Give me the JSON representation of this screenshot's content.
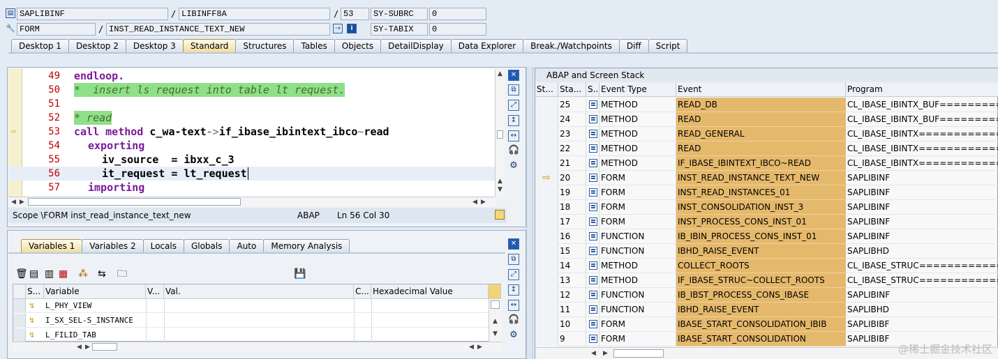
{
  "header": {
    "program_icon": "program-icon",
    "program": "SAPLIBINF",
    "include": "LIBINFF8A",
    "line": "53",
    "sysvar1_label": "SY-SUBRC",
    "sysvar1_value": "0",
    "event_type": "FORM",
    "event_name": "INST_READ_INSTANCE_TEXT_NEW",
    "sysvar2_label": "SY-TABIX",
    "sysvar2_value": "0",
    "sep_slash": "/"
  },
  "desktop_tabs": [
    "Desktop 1",
    "Desktop 2",
    "Desktop 3",
    "Standard",
    "Structures",
    "Tables",
    "Objects",
    "DetailDisplay",
    "Data Explorer",
    "Break./Watchpoints",
    "Diff",
    "Script"
  ],
  "code": {
    "lines": [
      {
        "no": "49",
        "text": "endloop."
      },
      {
        "no": "50",
        "text": "*  insert ls request into table lt request."
      },
      {
        "no": "51",
        "text": ""
      },
      {
        "no": "52",
        "text": "* read"
      },
      {
        "no": "53",
        "text": "call method c_wa-text->if_ibase_ibintext_ibco~read"
      },
      {
        "no": "54",
        "text": "exporting"
      },
      {
        "no": "55",
        "text": "iv_source  = ibxx_c_3"
      },
      {
        "no": "56",
        "text": "it_request = lt_request"
      },
      {
        "no": "57",
        "text": "importing"
      }
    ]
  },
  "status": {
    "scope": "Scope \\FORM inst_read_instance_text_new",
    "lang": "ABAP",
    "ln": "Ln  56 Col  30"
  },
  "var_tabs": [
    "Variables 1",
    "Variables 2",
    "Locals",
    "Globals",
    "Auto",
    "Memory Analysis"
  ],
  "var_table": {
    "headers": [
      "S...",
      "Variable",
      "V...",
      "Val.",
      "C...",
      "Hexadecimal Value"
    ],
    "rows": [
      "L_PHY_VIEW",
      "I_SX_SEL-S_INSTANCE",
      "L_FILID_TAB"
    ]
  },
  "stack": {
    "title": "ABAP and Screen Stack",
    "headers": [
      "St...",
      "Sta...",
      "S...",
      "Event Type",
      "Event",
      "Program"
    ],
    "rows": [
      {
        "no": "25",
        "type": "METHOD",
        "event": "READ_DB",
        "program": "CL_IBASE_IBINTX_BUF=========="
      },
      {
        "no": "24",
        "type": "METHOD",
        "event": "READ",
        "program": "CL_IBASE_IBINTX_BUF=========="
      },
      {
        "no": "23",
        "type": "METHOD",
        "event": "READ_GENERAL",
        "program": "CL_IBASE_IBINTX=============="
      },
      {
        "no": "22",
        "type": "METHOD",
        "event": "READ",
        "program": "CL_IBASE_IBINTX=============="
      },
      {
        "no": "21",
        "type": "METHOD",
        "event": "IF_IBASE_IBINTEXT_IBCO~READ",
        "program": "CL_IBASE_IBINTX=============="
      },
      {
        "no": "20",
        "type": "FORM",
        "event": "INST_READ_INSTANCE_TEXT_NEW",
        "program": "SAPLIBINF"
      },
      {
        "no": "19",
        "type": "FORM",
        "event": "INST_READ_INSTANCES_01",
        "program": "SAPLIBINF"
      },
      {
        "no": "18",
        "type": "FORM",
        "event": "INST_CONSOLIDATION_INST_3",
        "program": "SAPLIBINF"
      },
      {
        "no": "17",
        "type": "FORM",
        "event": "INST_PROCESS_CONS_INST_01",
        "program": "SAPLIBINF"
      },
      {
        "no": "16",
        "type": "FUNCTION",
        "event": "IB_IBIN_PROCESS_CONS_INST_01",
        "program": "SAPLIBINF"
      },
      {
        "no": "15",
        "type": "FUNCTION",
        "event": "IBHD_RAISE_EVENT",
        "program": "SAPLIBHD"
      },
      {
        "no": "14",
        "type": "METHOD",
        "event": "COLLECT_ROOTS",
        "program": "CL_IBASE_STRUC=============="
      },
      {
        "no": "13",
        "type": "METHOD",
        "event": "IF_IBASE_STRUC~COLLECT_ROOTS",
        "program": "CL_IBASE_STRUC=============="
      },
      {
        "no": "12",
        "type": "FUNCTION",
        "event": "IB_IBST_PROCESS_CONS_IBASE",
        "program": "SAPLIBINF"
      },
      {
        "no": "11",
        "type": "FUNCTION",
        "event": "IBHD_RAISE_EVENT",
        "program": "SAPLIBHD"
      },
      {
        "no": "10",
        "type": "FORM",
        "event": "IBASE_START_CONSOLIDATION_IBIB",
        "program": "SAPLIBIBF"
      },
      {
        "no": "9",
        "type": "FORM",
        "event": "IBASE_START_CONSOLIDATION",
        "program": "SAPLIBIBF"
      }
    ]
  },
  "watermark": "@稀土掘金技术社区"
}
